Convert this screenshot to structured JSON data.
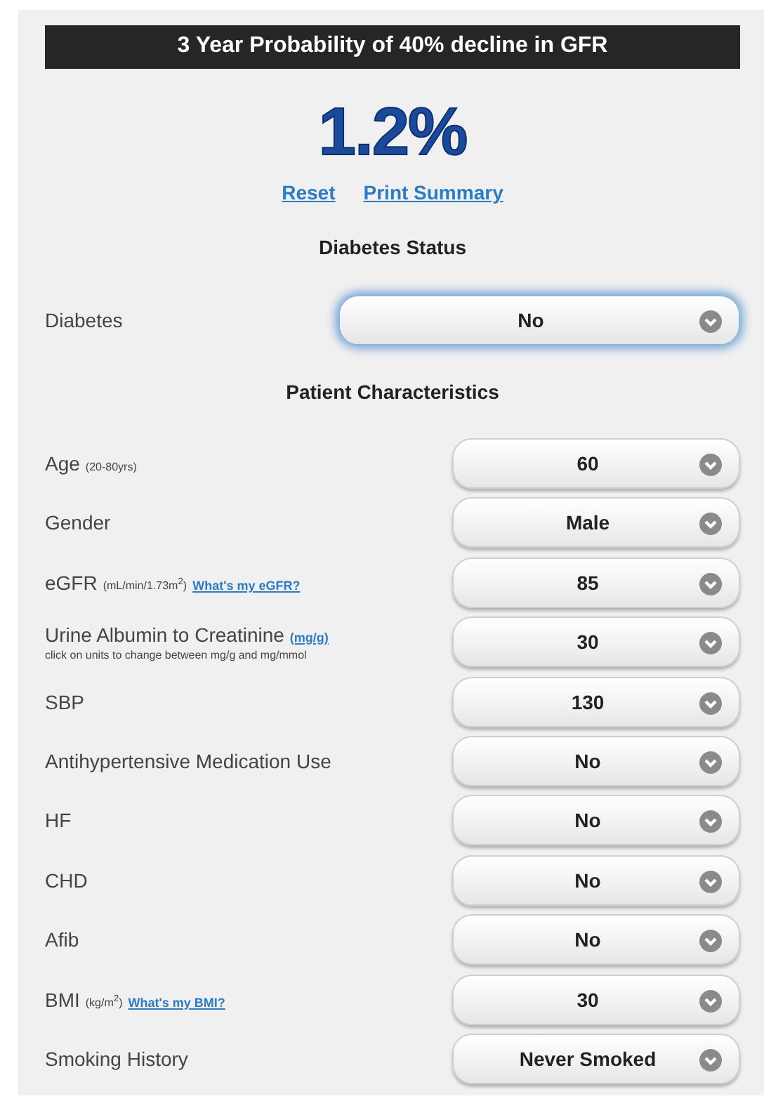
{
  "banner": {
    "title": "3 Year Probability of 40% decline in GFR"
  },
  "result": "1.2%",
  "links": [
    "Reset",
    "Print Summary"
  ],
  "sections": [
    {
      "heading": "Diabetes Status",
      "wide": true,
      "fields": [
        {
          "label": "Diabetes",
          "value": "No",
          "focused": true
        }
      ]
    },
    {
      "heading": "Patient Characteristics",
      "wide": false,
      "fields": [
        {
          "label": "Age",
          "unit": "(20-80yrs)",
          "value": "60",
          "focused": false
        },
        {
          "label": "Gender",
          "value": "Male",
          "focused": false
        },
        {
          "label": "eGFR",
          "unit": "(mL/min/1.73m$^{2}$)",
          "link": "What's my eGFR?",
          "value": "85",
          "focused": false
        },
        {
          "label": "Urine Albumin to Creatinine",
          "unit_link": "(mg/g)",
          "note": "click on units to change between mg/g and mg/mmol",
          "value": "30",
          "focused": false
        },
        {
          "label": "SBP",
          "value": "130",
          "focused": false
        },
        {
          "label": "Antihypertensive Medication Use",
          "value": "No",
          "focused": false
        },
        {
          "label": "HF",
          "value": "No",
          "focused": false
        },
        {
          "label": "CHD",
          "value": "No",
          "focused": false
        },
        {
          "label": "Afib",
          "value": "No",
          "focused": false
        },
        {
          "label": "BMI",
          "unit": "(kg/m$^{2}$)",
          "link": "What's my BMI?",
          "value": "30",
          "focused": false
        },
        {
          "label": "Smoking History",
          "value": "Never Smoked",
          "focused": false
        }
      ]
    }
  ]
}
